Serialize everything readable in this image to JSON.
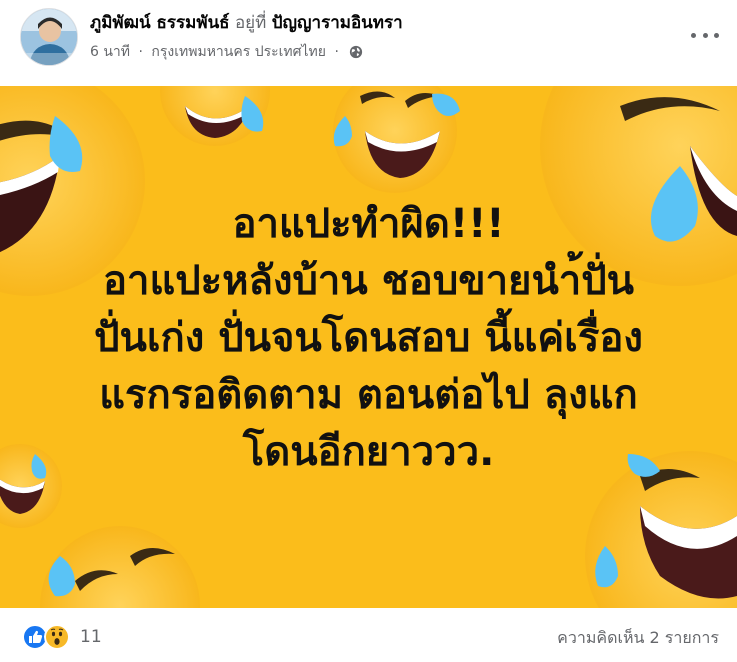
{
  "post": {
    "author": "ภูมิพัฒน์ ธรรมพันธ์",
    "at_word": "อยู่ที่",
    "place": "ปัญญารามอินทรา",
    "time": "6 นาที",
    "separator": "·",
    "location": "กรุงเทพมหานคร ประเทศไทย",
    "privacy_icon": "globe-icon",
    "more_icon": "more-options-icon",
    "image_text": [
      "อาแปะทำผิด!!!",
      "อาแปะหลังบ้าน ชอบขายนำ้ปั่น",
      "ปั่นเก่ง ปั่นจนโดนสอบ นี้แค่เรื่อง",
      "แรกรอติดตาม ตอนต่อไป ลุงแก",
      "โดนอีกยาววว."
    ],
    "background_color": "#fbbd1b"
  },
  "footer": {
    "reaction_icons": [
      "like-icon",
      "wow-icon"
    ],
    "reaction_count": "11",
    "comments": "ความคิดเห็น 2 รายการ"
  }
}
